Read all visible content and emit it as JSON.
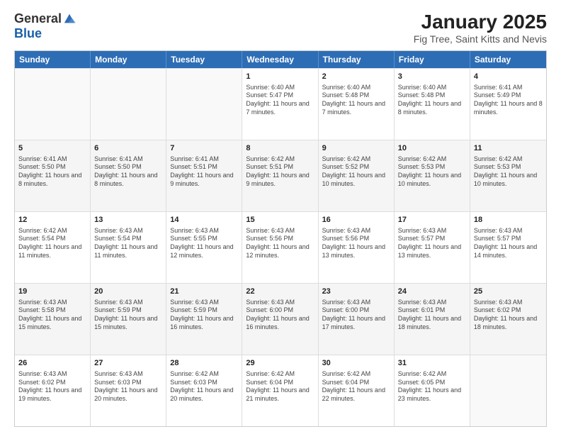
{
  "logo": {
    "general": "General",
    "blue": "Blue"
  },
  "title": "January 2025",
  "subtitle": "Fig Tree, Saint Kitts and Nevis",
  "days": [
    "Sunday",
    "Monday",
    "Tuesday",
    "Wednesday",
    "Thursday",
    "Friday",
    "Saturday"
  ],
  "weeks": [
    [
      {
        "day": "",
        "info": ""
      },
      {
        "day": "",
        "info": ""
      },
      {
        "day": "",
        "info": ""
      },
      {
        "day": "1",
        "info": "Sunrise: 6:40 AM\nSunset: 5:47 PM\nDaylight: 11 hours and 7 minutes."
      },
      {
        "day": "2",
        "info": "Sunrise: 6:40 AM\nSunset: 5:48 PM\nDaylight: 11 hours and 7 minutes."
      },
      {
        "day": "3",
        "info": "Sunrise: 6:40 AM\nSunset: 5:48 PM\nDaylight: 11 hours and 8 minutes."
      },
      {
        "day": "4",
        "info": "Sunrise: 6:41 AM\nSunset: 5:49 PM\nDaylight: 11 hours and 8 minutes."
      }
    ],
    [
      {
        "day": "5",
        "info": "Sunrise: 6:41 AM\nSunset: 5:50 PM\nDaylight: 11 hours and 8 minutes."
      },
      {
        "day": "6",
        "info": "Sunrise: 6:41 AM\nSunset: 5:50 PM\nDaylight: 11 hours and 8 minutes."
      },
      {
        "day": "7",
        "info": "Sunrise: 6:41 AM\nSunset: 5:51 PM\nDaylight: 11 hours and 9 minutes."
      },
      {
        "day": "8",
        "info": "Sunrise: 6:42 AM\nSunset: 5:51 PM\nDaylight: 11 hours and 9 minutes."
      },
      {
        "day": "9",
        "info": "Sunrise: 6:42 AM\nSunset: 5:52 PM\nDaylight: 11 hours and 10 minutes."
      },
      {
        "day": "10",
        "info": "Sunrise: 6:42 AM\nSunset: 5:53 PM\nDaylight: 11 hours and 10 minutes."
      },
      {
        "day": "11",
        "info": "Sunrise: 6:42 AM\nSunset: 5:53 PM\nDaylight: 11 hours and 10 minutes."
      }
    ],
    [
      {
        "day": "12",
        "info": "Sunrise: 6:42 AM\nSunset: 5:54 PM\nDaylight: 11 hours and 11 minutes."
      },
      {
        "day": "13",
        "info": "Sunrise: 6:43 AM\nSunset: 5:54 PM\nDaylight: 11 hours and 11 minutes."
      },
      {
        "day": "14",
        "info": "Sunrise: 6:43 AM\nSunset: 5:55 PM\nDaylight: 11 hours and 12 minutes."
      },
      {
        "day": "15",
        "info": "Sunrise: 6:43 AM\nSunset: 5:56 PM\nDaylight: 11 hours and 12 minutes."
      },
      {
        "day": "16",
        "info": "Sunrise: 6:43 AM\nSunset: 5:56 PM\nDaylight: 11 hours and 13 minutes."
      },
      {
        "day": "17",
        "info": "Sunrise: 6:43 AM\nSunset: 5:57 PM\nDaylight: 11 hours and 13 minutes."
      },
      {
        "day": "18",
        "info": "Sunrise: 6:43 AM\nSunset: 5:57 PM\nDaylight: 11 hours and 14 minutes."
      }
    ],
    [
      {
        "day": "19",
        "info": "Sunrise: 6:43 AM\nSunset: 5:58 PM\nDaylight: 11 hours and 15 minutes."
      },
      {
        "day": "20",
        "info": "Sunrise: 6:43 AM\nSunset: 5:59 PM\nDaylight: 11 hours and 15 minutes."
      },
      {
        "day": "21",
        "info": "Sunrise: 6:43 AM\nSunset: 5:59 PM\nDaylight: 11 hours and 16 minutes."
      },
      {
        "day": "22",
        "info": "Sunrise: 6:43 AM\nSunset: 6:00 PM\nDaylight: 11 hours and 16 minutes."
      },
      {
        "day": "23",
        "info": "Sunrise: 6:43 AM\nSunset: 6:00 PM\nDaylight: 11 hours and 17 minutes."
      },
      {
        "day": "24",
        "info": "Sunrise: 6:43 AM\nSunset: 6:01 PM\nDaylight: 11 hours and 18 minutes."
      },
      {
        "day": "25",
        "info": "Sunrise: 6:43 AM\nSunset: 6:02 PM\nDaylight: 11 hours and 18 minutes."
      }
    ],
    [
      {
        "day": "26",
        "info": "Sunrise: 6:43 AM\nSunset: 6:02 PM\nDaylight: 11 hours and 19 minutes."
      },
      {
        "day": "27",
        "info": "Sunrise: 6:43 AM\nSunset: 6:03 PM\nDaylight: 11 hours and 20 minutes."
      },
      {
        "day": "28",
        "info": "Sunrise: 6:42 AM\nSunset: 6:03 PM\nDaylight: 11 hours and 20 minutes."
      },
      {
        "day": "29",
        "info": "Sunrise: 6:42 AM\nSunset: 6:04 PM\nDaylight: 11 hours and 21 minutes."
      },
      {
        "day": "30",
        "info": "Sunrise: 6:42 AM\nSunset: 6:04 PM\nDaylight: 11 hours and 22 minutes."
      },
      {
        "day": "31",
        "info": "Sunrise: 6:42 AM\nSunset: 6:05 PM\nDaylight: 11 hours and 23 minutes."
      },
      {
        "day": "",
        "info": ""
      }
    ]
  ]
}
